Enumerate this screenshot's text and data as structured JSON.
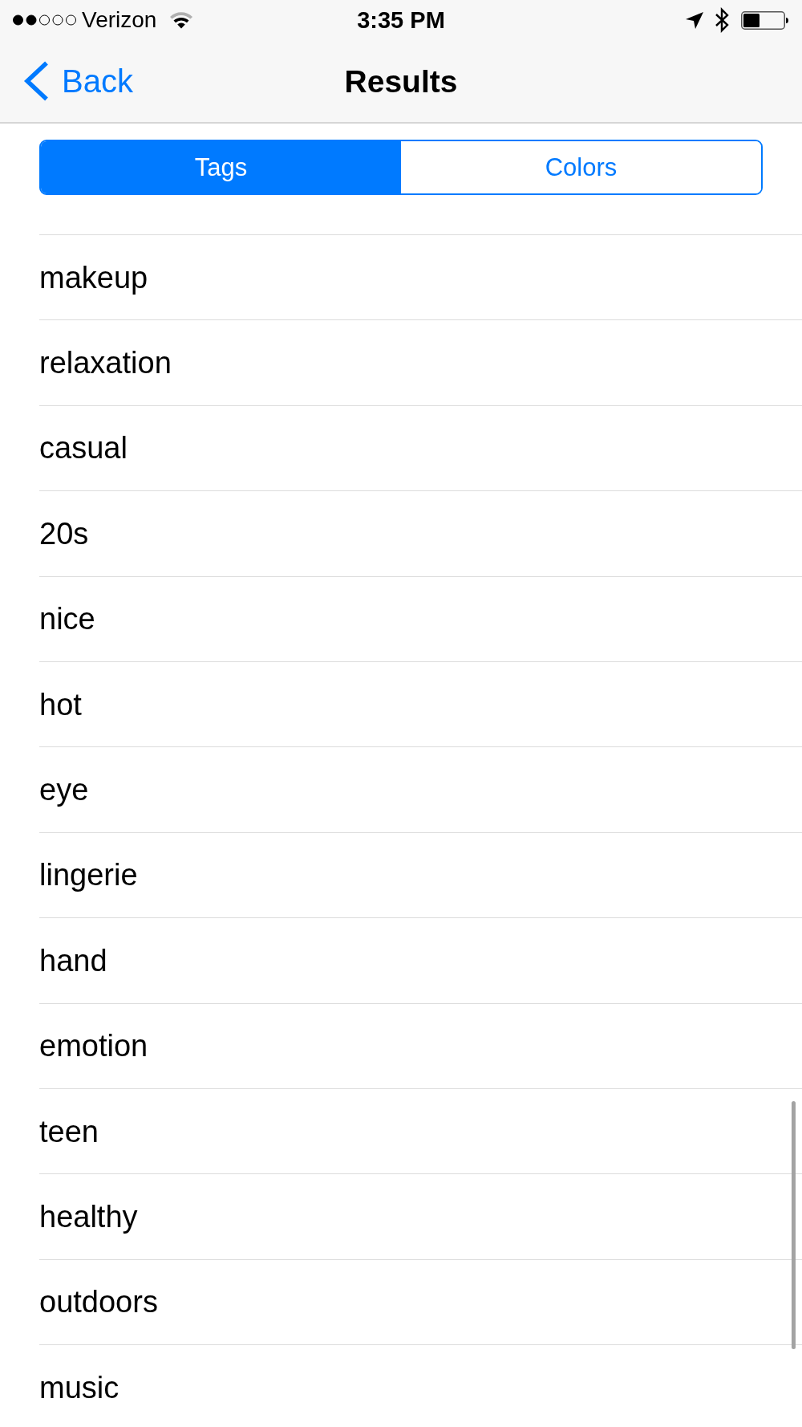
{
  "status_bar": {
    "carrier": "Verizon",
    "time": "3:35 PM"
  },
  "nav_bar": {
    "back_label": "Back",
    "title": "Results"
  },
  "segments": [
    {
      "label": "Tags",
      "selected": true
    },
    {
      "label": "Colors",
      "selected": false
    }
  ],
  "rows": [
    "makeup",
    "relaxation",
    "casual",
    "20s",
    "nice",
    "hot",
    "eye",
    "lingerie",
    "hand",
    "emotion",
    "teen",
    "healthy",
    "outdoors",
    "music"
  ]
}
